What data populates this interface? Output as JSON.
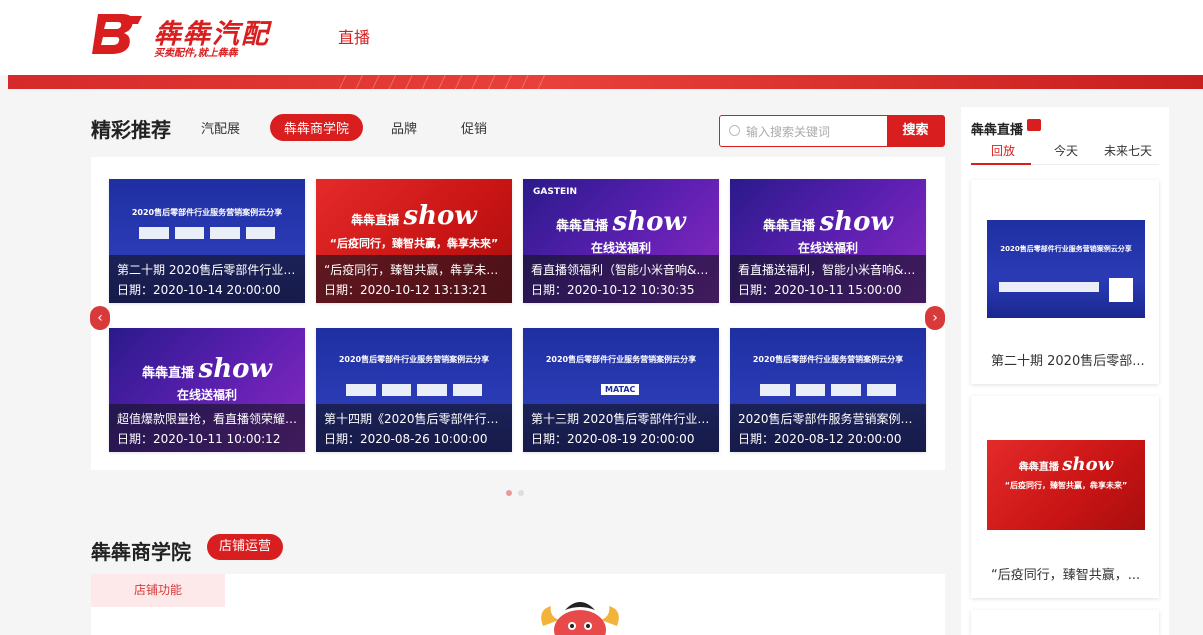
{
  "header": {
    "logo_name": "犇犇汽配",
    "logo_slogan": "买卖配件,就上犇犇",
    "nav_live": "直播"
  },
  "featured": {
    "title": "精彩推荐",
    "tabs": [
      {
        "label": "汽配展",
        "active": false
      },
      {
        "label": "犇犇商学院",
        "active": true
      },
      {
        "label": "品牌",
        "active": false
      },
      {
        "label": "促销",
        "active": false
      }
    ],
    "search": {
      "placeholder": "输入搜索关键词",
      "button": "搜索"
    },
    "cards": [
      {
        "title": "第二十期 2020售后零部件行业服务...",
        "date": "日期：2020-10-14 20:00:00",
        "style": "blue",
        "headline": "2020售后零部件行业服务营销案例云分享"
      },
      {
        "title": "“后疫同行，臻智共赢，犇享未来...",
        "date": "日期：2020-10-12 13:13:21",
        "style": "red",
        "headline": "“后疫同行，臻智共赢，犇享未来”",
        "show_top": "犇犇直播",
        "show_word": "show"
      },
      {
        "title": "看直播领福利（智能小米音响&爆...",
        "date": "日期：2020-10-12 10:30:35",
        "style": "purple",
        "brand": "GASTEIN",
        "show_top": "犇犇直播",
        "show_word": "show",
        "sub": "在线送福利"
      },
      {
        "title": "看直播送福利，智能小米音响&爆...",
        "date": "日期：2020-10-11 15:00:00",
        "style": "purple",
        "show_top": "犇犇直播",
        "show_word": "show",
        "sub": "在线送福利"
      },
      {
        "title": "超值爆款限量抢，看直播领荣耀手...",
        "date": "日期：2020-10-11 10:00:12",
        "style": "purple",
        "show_top": "犇犇直播",
        "show_word": "show",
        "sub": "在线送福利"
      },
      {
        "title": "第十四期《2020售后零部件行业服...",
        "date": "日期：2020-08-26 10:00:00",
        "style": "blue",
        "headline": "2020售后零部件行业服务营销案例云分享"
      },
      {
        "title": "第十三期 2020售后零部件行业服务...",
        "date": "日期：2020-08-19 20:00:00",
        "style": "blue",
        "headline": "2020售后零部件行业服务营销案例云分享",
        "brand": "MATAC"
      },
      {
        "title": "2020售后零部件服务营销案例云分享",
        "date": "日期：2020-08-12 20:00:00",
        "style": "blue",
        "headline": "2020售后零部件行业服务营销案例云分享"
      }
    ],
    "arrow_prev": "‹",
    "arrow_next": "›",
    "page_count": 2,
    "active_page": 1
  },
  "academy": {
    "title": "犇犇商学院",
    "tag": "店铺运营",
    "tab": "店铺功能"
  },
  "sidebar": {
    "title": "犇犇直播",
    "tabs": [
      {
        "label": "回放",
        "active": true
      },
      {
        "label": "今天",
        "active": false
      },
      {
        "label": "未来七天",
        "active": false
      }
    ],
    "cards": [
      {
        "caption": "第二十期 2020售后零部... ",
        "style": "blue",
        "headline": "2020售后零部件行业服务营销案例云分享"
      },
      {
        "caption": "“后疫同行，臻智共赢，...",
        "style": "red",
        "show_top": "犇犇直播",
        "show_word": "show",
        "headline": "“后疫同行，臻智共赢，犇享未来”"
      }
    ]
  },
  "colors": {
    "brand_red": "#d81e1e",
    "card_blue": "#2a3bb5",
    "card_purple": "#5a1fb0"
  },
  "icons": {
    "search": "search-icon",
    "tv": "tv-icon",
    "prev": "chevron-left-icon",
    "next": "chevron-right-icon"
  }
}
